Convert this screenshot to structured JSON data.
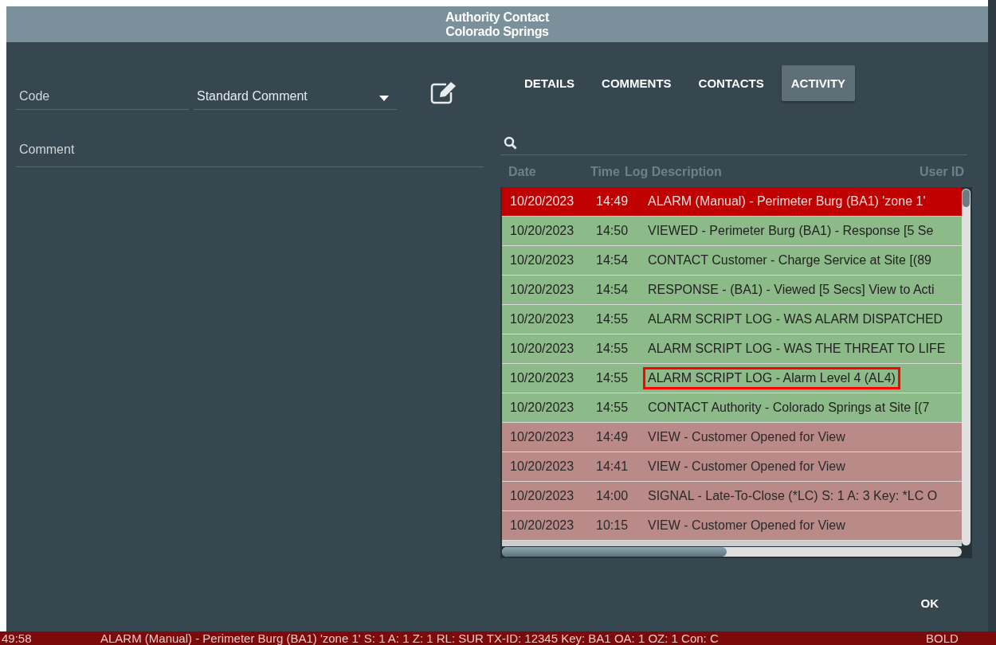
{
  "dialog": {
    "title_lines": [
      "Authority Contact",
      "Colorado Springs"
    ]
  },
  "form": {
    "code": {
      "placeholder": "Code"
    },
    "standard_comment": {
      "value": "Standard Comment"
    },
    "comment": {
      "placeholder": "Comment"
    }
  },
  "tabs": [
    {
      "label": "DETAILS",
      "selected": false
    },
    {
      "label": "COMMENTS",
      "selected": false
    },
    {
      "label": "CONTACTS",
      "selected": false
    },
    {
      "label": "ACTIVITY",
      "selected": true
    }
  ],
  "activity": {
    "columns": [
      "Date",
      "Time",
      "Log Description",
      "User ID"
    ],
    "rows": [
      {
        "date": "10/20/2023",
        "time": "14:49",
        "description": "ALARM (Manual) - Perimeter Burg (BA1) 'zone 1'",
        "kind": "alarm",
        "highlighted": false
      },
      {
        "date": "10/20/2023",
        "time": "14:50",
        "description": "VIEWED - Perimeter Burg (BA1) - Response [5 Se",
        "kind": "handled",
        "highlighted": false
      },
      {
        "date": "10/20/2023",
        "time": "14:54",
        "description": "CONTACT Customer - Charge Service at Site [(89",
        "kind": "handled",
        "highlighted": false
      },
      {
        "date": "10/20/2023",
        "time": "14:54",
        "description": "RESPONSE - (BA1) - Viewed [5 Secs] View to Acti",
        "kind": "handled",
        "highlighted": false
      },
      {
        "date": "10/20/2023",
        "time": "14:55",
        "description": "ALARM SCRIPT LOG - WAS ALARM DISPATCHED",
        "kind": "handled",
        "highlighted": false
      },
      {
        "date": "10/20/2023",
        "time": "14:55",
        "description": "ALARM SCRIPT LOG - WAS THE THREAT TO LIFE",
        "kind": "handled",
        "highlighted": false
      },
      {
        "date": "10/20/2023",
        "time": "14:55",
        "description": "ALARM SCRIPT LOG - Alarm Level 4 (AL4)",
        "kind": "handled",
        "highlighted": true
      },
      {
        "date": "10/20/2023",
        "time": "14:55",
        "description": "CONTACT Authority - Colorado Springs at Site [(7",
        "kind": "handled",
        "highlighted": false
      },
      {
        "date": "10/20/2023",
        "time": "14:49",
        "description": "VIEW - Customer Opened for View",
        "kind": "event",
        "highlighted": false
      },
      {
        "date": "10/20/2023",
        "time": "14:41",
        "description": "VIEW - Customer Opened for View",
        "kind": "event",
        "highlighted": false
      },
      {
        "date": "10/20/2023",
        "time": "14:00",
        "description": "SIGNAL - Late-To-Close (*LC) S: 1 A: 3 Key: *LC O",
        "kind": "event",
        "highlighted": false
      },
      {
        "date": "10/20/2023",
        "time": "10:15",
        "description": "VIEW - Customer Opened for View",
        "kind": "event",
        "highlighted": false
      }
    ]
  },
  "ok_button": "OK",
  "status_bar": {
    "time": "49:58",
    "message": "ALARM (Manual) - Perimeter Burg (BA1) 'zone 1' S: 1 A: 1 Z: 1 RL: SUR TX-ID: 12345 Key: BA1 OA: 1 OZ: 1 Con: C",
    "user": "BOLD"
  }
}
